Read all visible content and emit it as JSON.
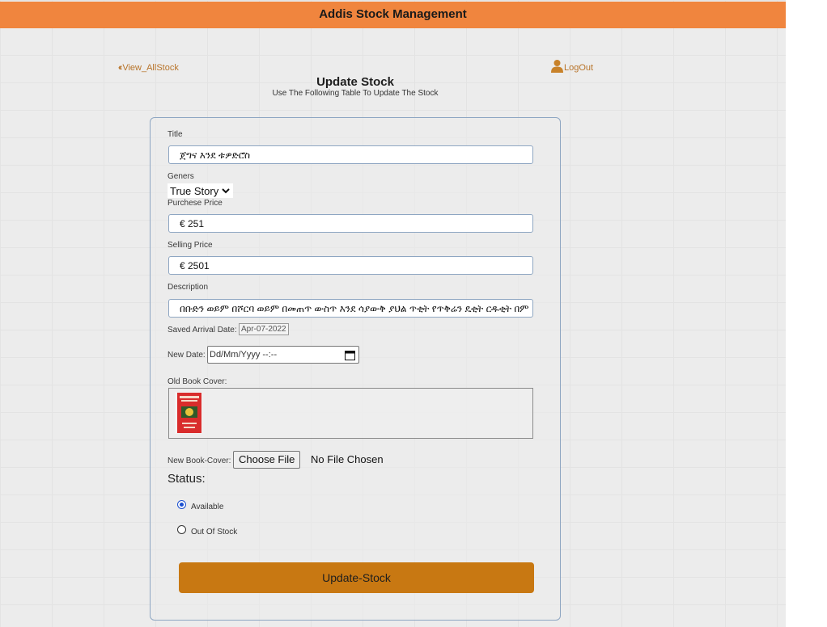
{
  "app": {
    "title": "Addis Stock Management"
  },
  "nav": {
    "back_label": "View_AllStock",
    "logout_label": "LogOut"
  },
  "heading": {
    "title": "Update Stock",
    "subtitle": "Use The Following Table To Update The Stock"
  },
  "form": {
    "title_label": "Title",
    "title_value": "ጀግና እንደ ቱዎድሮስ",
    "genres_label": "Geners",
    "genre_selected": "True Story",
    "purchase_label": "Purchese Price",
    "purchase_value": "€ 251",
    "selling_label": "Selling Price",
    "selling_value": "€ 2501",
    "description_label": "Description",
    "description_value": "በቡድን ወይም በሾርባ ወይም በመጠጥ ውስጥ እንደ ሳያውቅ ያህል ጥቂት የጥቅሬን ዴቂት ርዱቂት በም",
    "saved_date_label": "Saved Arrival Date:",
    "saved_date_value": "Apr-07-2022",
    "new_date_label": "New Date:",
    "new_date_placeholder": "Dd/Mm/Yyyy --:--",
    "old_cover_label": "Old Book Cover:",
    "new_cover_label": "New Book-Cover:",
    "choose_file_label": "Choose File",
    "no_file_label": "No File Chosen",
    "status_label": "Status:",
    "status_options": [
      "Available",
      "Out Of Stock"
    ],
    "status_selected": "Available",
    "submit_label": "Update-Stock"
  },
  "colors": {
    "header": "#f0853e",
    "link": "#b8742a",
    "submit": "#c87812",
    "field_border": "#8ea6c2"
  }
}
